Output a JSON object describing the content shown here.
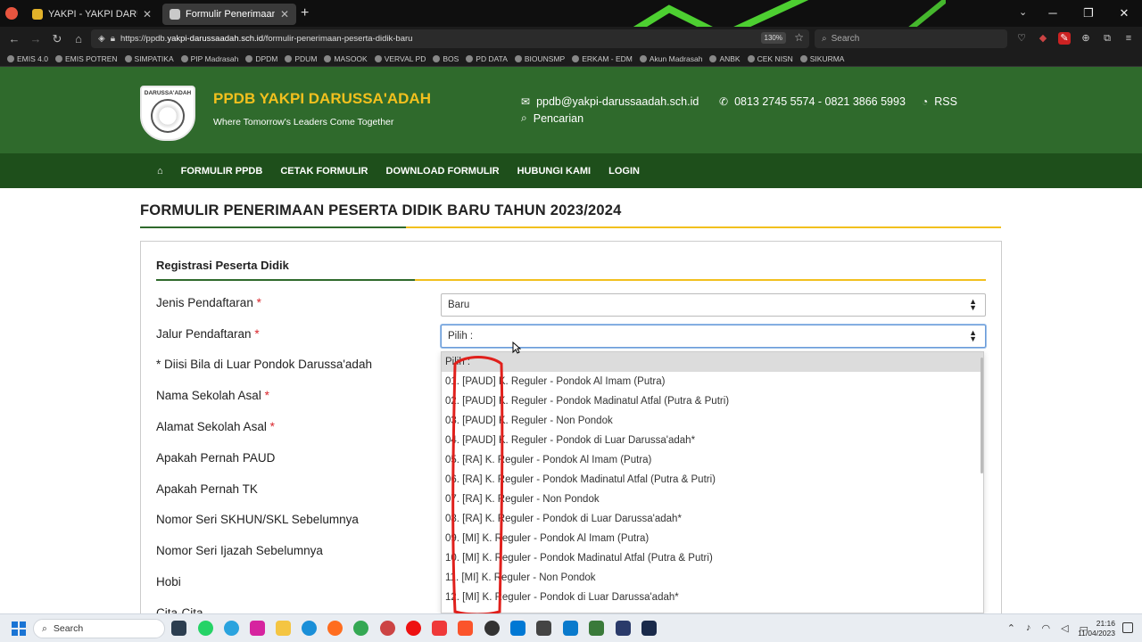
{
  "browser": {
    "tabs": [
      {
        "title": "YAKPI - YAKPI DARUSSA'ADAH",
        "active": false
      },
      {
        "title": "Formulir Penerimaan Peserta D",
        "active": true
      }
    ],
    "url_prefix": "https://ppdb.",
    "url_domain": "yakpi-darussaadah.sch.id",
    "url_path": "/formulir-penerimaan-peserta-didik-baru",
    "zoom": "130%",
    "search_placeholder": "Search",
    "bookmarks": [
      "EMIS 4.0",
      "EMIS POTREN",
      "SIMPATIKA",
      "PIP Madrasah",
      "DPDM",
      "PDUM",
      "MASOOK",
      "VERVAL PD",
      "BOS",
      "PD DATA",
      "BIOUNSMP",
      "ERKAM - EDM",
      "Akun Madrasah",
      "ANBK",
      "CEK NISN",
      "SIKURMA"
    ]
  },
  "site": {
    "logo_text": "DARUSSA'ADAH",
    "title": "PPDB YAKPI DARUSSA'ADAH",
    "tagline": "Where Tomorrow's Leaders Come Together",
    "email": "ppdb@yakpi-darussaadah.sch.id",
    "phone": "0813 2745 5574 - 0821 3866 5993",
    "rss": "RSS",
    "search_link": "Pencarian",
    "menu": [
      "FORMULIR PPDB",
      "CETAK FORMULIR",
      "DOWNLOAD FORMULIR",
      "HUBUNGI KAMI",
      "LOGIN"
    ]
  },
  "page": {
    "title": "FORMULIR PENERIMAAN PESERTA DIDIK BARU TAHUN 2023/2024",
    "section_title": "Registrasi Peserta Didik",
    "fields": [
      {
        "label": "Jenis Pendaftaran",
        "required": "*"
      },
      {
        "label": "Jalur Pendaftaran",
        "required": "*"
      },
      {
        "label": "* Diisi Bila di Luar Pondok Darussa'adah",
        "required": ""
      },
      {
        "label": "Nama Sekolah Asal",
        "required": "*"
      },
      {
        "label": "Alamat Sekolah Asal",
        "required": "*"
      },
      {
        "label": "Apakah Pernah PAUD",
        "required": ""
      },
      {
        "label": "Apakah Pernah TK",
        "required": ""
      },
      {
        "label": "Nomor Seri SKHUN/SKL Sebelumnya",
        "required": ""
      },
      {
        "label": "Nomor Seri Ijazah Sebelumnya",
        "required": ""
      },
      {
        "label": "Hobi",
        "required": ""
      },
      {
        "label": "Cita-Cita",
        "required": ""
      }
    ],
    "jenis_value": "Baru",
    "jalur_value": "Pilih :",
    "dropdown_options": [
      "Pilih :",
      "01. [PAUD] K. Reguler - Pondok Al Imam (Putra)",
      "02. [PAUD] K. Reguler - Pondok Madinatul Atfal (Putra & Putri)",
      "03. [PAUD] K. Reguler - Non Pondok",
      "04. [PAUD] K. Reguler - Pondok di Luar Darussa'adah*",
      "05. [RA] K. Reguler - Pondok Al Imam (Putra)",
      "06. [RA] K. Reguler - Pondok Madinatul Atfal (Putra & Putri)",
      "07. [RA] K. Reguler - Non Pondok",
      "08. [RA] K. Reguler - Pondok di Luar Darussa'adah*",
      "09. [MI] K. Reguler - Pondok Al Imam (Putra)",
      "10. [MI] K. Reguler - Pondok Madinatul Atfal (Putra & Putri)",
      "11. [MI] K. Reguler - Non Pondok",
      "12. [MI] K. Reguler - Pondok di Luar Darussa'adah*"
    ]
  },
  "taskbar": {
    "search": "Search",
    "time": "21:16",
    "date": "11/04/2023"
  }
}
